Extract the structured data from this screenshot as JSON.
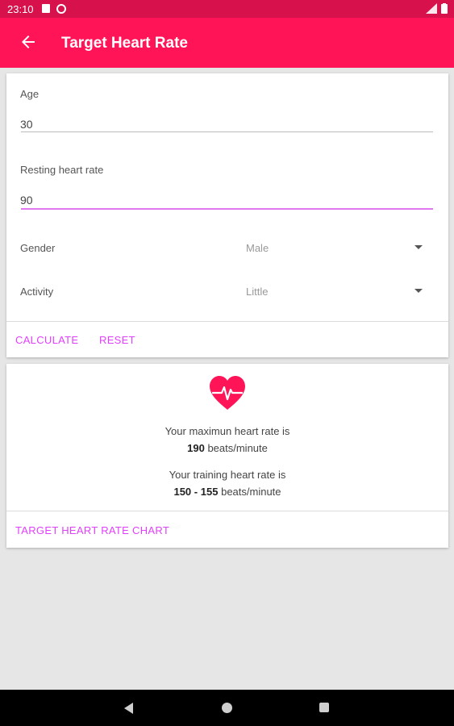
{
  "status_bar": {
    "time": "23:10"
  },
  "app_bar": {
    "title": "Target Heart Rate"
  },
  "form": {
    "age_label": "Age",
    "age_value": "30",
    "resting_label": "Resting heart rate",
    "resting_value": "90",
    "gender_label": "Gender",
    "gender_value": "Male",
    "activity_label": "Activity",
    "activity_value": "Little"
  },
  "actions": {
    "calculate": "CALCULATE",
    "reset": "RESET"
  },
  "result": {
    "max_intro": "Your maximun heart rate is",
    "max_value": "190",
    "unit": "beats/minute",
    "training_intro": "Your training heart rate is",
    "training_low": "150",
    "separator": "-",
    "training_high": "155",
    "chart_button": "TARGET HEART RATE CHART"
  },
  "colors": {
    "status_bar": "#d6114c",
    "app_bar": "#ff1457",
    "accent": "#e040fb",
    "heart": "#ff1457"
  }
}
